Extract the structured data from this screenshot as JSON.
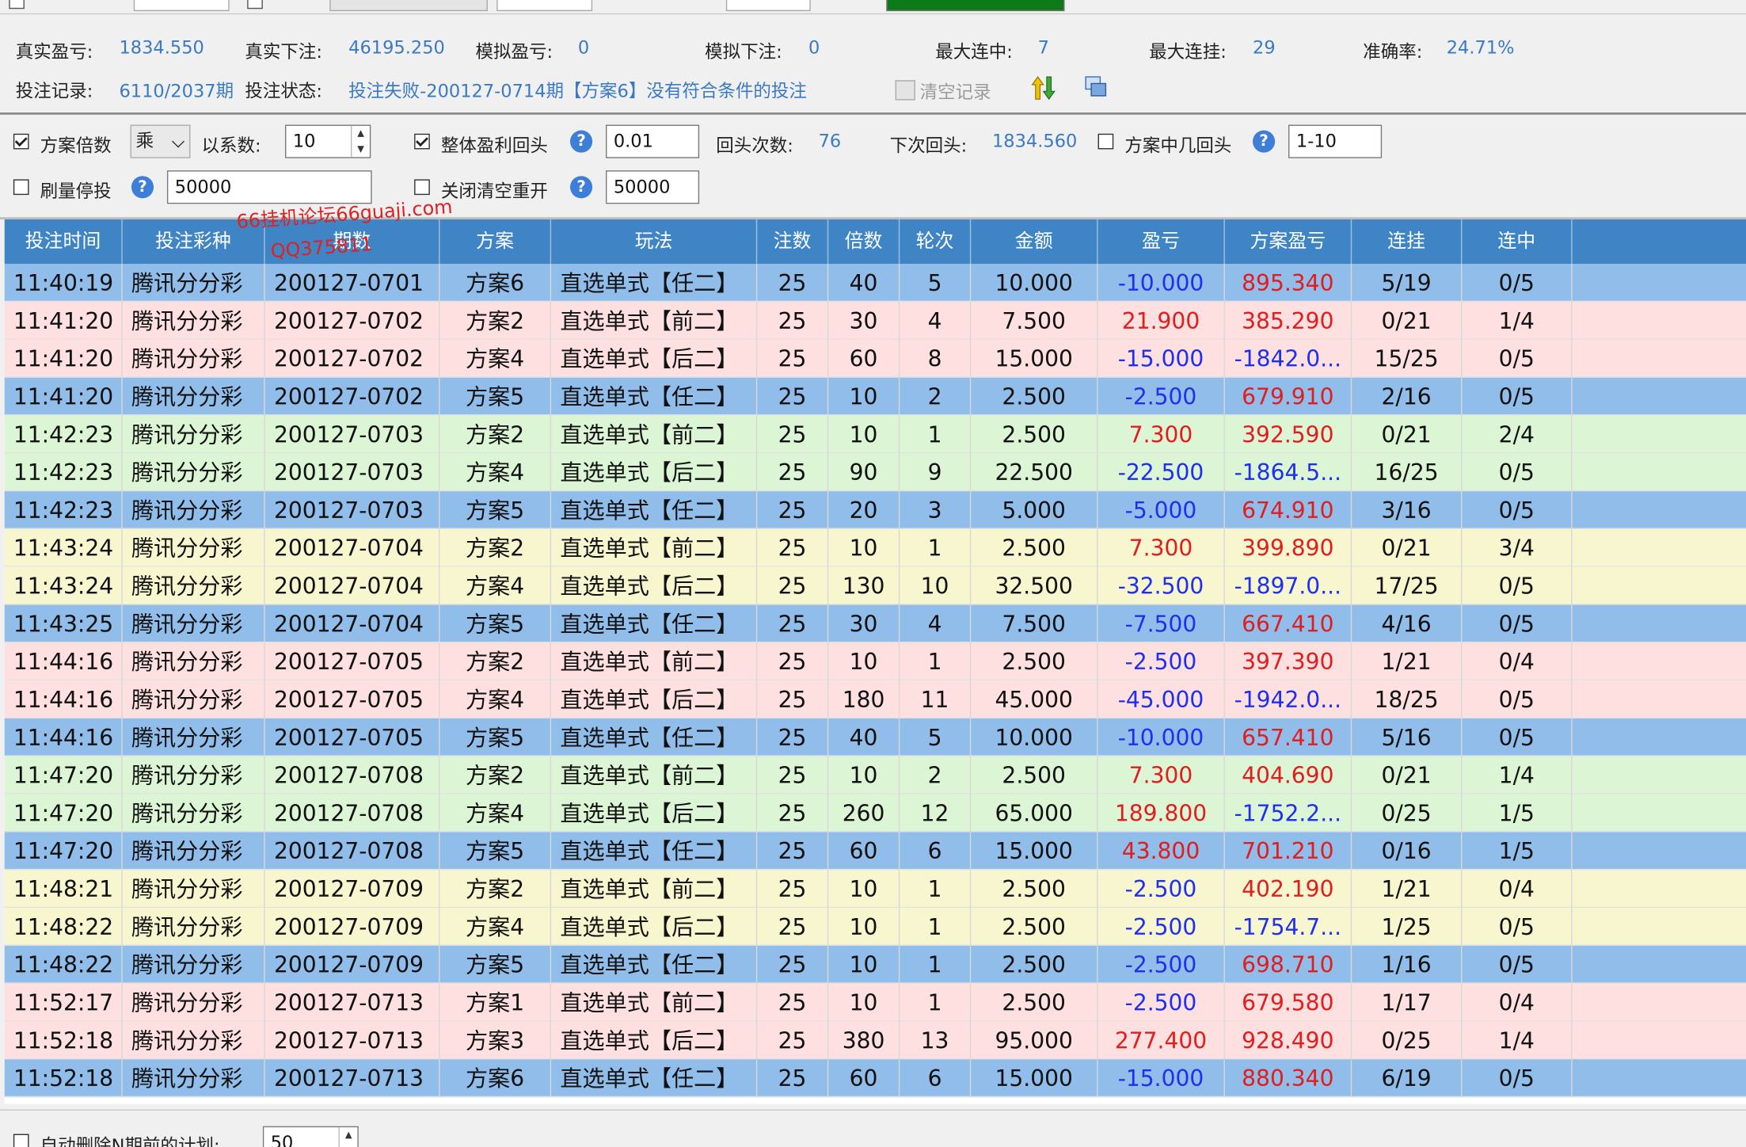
{
  "stats": {
    "real_profit_label": "真实盈亏:",
    "real_profit_value": "1834.550",
    "real_bet_label": "真实下注:",
    "real_bet_value": "46195.250",
    "sim_profit_label": "模拟盈亏:",
    "sim_profit_value": "0",
    "sim_bet_label": "模拟下注:",
    "sim_bet_value": "0",
    "max_win_streak_label": "最大连中:",
    "max_win_streak_value": "7",
    "max_loss_streak_label": "最大连挂:",
    "max_loss_streak_value": "29",
    "accuracy_label": "准确率:",
    "accuracy_value": "24.71%",
    "record_label": "投注记录:",
    "record_value": "6110/2037期",
    "status_label": "投注状态:",
    "status_value": "投注失败-200127-0714期【方案6】没有符合条件的投注",
    "clear_label": "清空记录"
  },
  "options": {
    "plan_multiplier_label": "方案倍数",
    "plan_multiplier_checked": true,
    "operator_value": "乘",
    "coefficient_label": "以系数:",
    "coefficient_value": "10",
    "overall_profit_label": "整体盈利回头",
    "overall_profit_checked": true,
    "overall_profit_value": "0.01",
    "return_count_label": "回头次数:",
    "return_count_value": "76",
    "next_return_label": "下次回头:",
    "next_return_value": "1834.560",
    "plan_return_label": "方案中几回头",
    "plan_return_checked": false,
    "plan_return_value": "1-10",
    "volume_stop_label": "刷量停投",
    "volume_stop_checked": false,
    "volume_stop_value": "50000",
    "close_clear_label": "关闭清空重开",
    "close_clear_checked": false,
    "close_clear_value": "50000"
  },
  "watermark": {
    "line1": "66挂机论坛66guaji.com",
    "line2": "QQ375811"
  },
  "table": {
    "columns": [
      "投注时间",
      "投注彩种",
      "期数",
      "方案",
      "玩法",
      "注数",
      "倍数",
      "轮次",
      "金额",
      "盈亏",
      "方案盈亏",
      "连挂",
      "连中"
    ],
    "rows": [
      {
        "bg": "blue",
        "time": "11:40:19",
        "lottery": "腾讯分分彩",
        "period": "200127-0701",
        "plan": "方案6",
        "play": "直选单式【任二】",
        "count": "25",
        "mult": "40",
        "round": "5",
        "amount": "10.000",
        "profit": "-10.000",
        "profit_sign": "neg",
        "plan_profit": "895.340",
        "plan_sign": "pos",
        "loss_streak": "5/19",
        "win_streak": "0/5"
      },
      {
        "bg": "pink",
        "time": "11:41:20",
        "lottery": "腾讯分分彩",
        "period": "200127-0702",
        "plan": "方案2",
        "play": "直选单式【前二】",
        "count": "25",
        "mult": "30",
        "round": "4",
        "amount": "7.500",
        "profit": "21.900",
        "profit_sign": "pos",
        "plan_profit": "385.290",
        "plan_sign": "pos",
        "loss_streak": "0/21",
        "win_streak": "1/4"
      },
      {
        "bg": "pink",
        "time": "11:41:20",
        "lottery": "腾讯分分彩",
        "period": "200127-0702",
        "plan": "方案4",
        "play": "直选单式【后二】",
        "count": "25",
        "mult": "60",
        "round": "8",
        "amount": "15.000",
        "profit": "-15.000",
        "profit_sign": "neg",
        "plan_profit": "-1842.0...",
        "plan_sign": "neg",
        "loss_streak": "15/25",
        "win_streak": "0/5"
      },
      {
        "bg": "blue",
        "time": "11:41:20",
        "lottery": "腾讯分分彩",
        "period": "200127-0702",
        "plan": "方案5",
        "play": "直选单式【任二】",
        "count": "25",
        "mult": "10",
        "round": "2",
        "amount": "2.500",
        "profit": "-2.500",
        "profit_sign": "neg",
        "plan_profit": "679.910",
        "plan_sign": "pos",
        "loss_streak": "2/16",
        "win_streak": "0/5"
      },
      {
        "bg": "green",
        "time": "11:42:23",
        "lottery": "腾讯分分彩",
        "period": "200127-0703",
        "plan": "方案2",
        "play": "直选单式【前二】",
        "count": "25",
        "mult": "10",
        "round": "1",
        "amount": "2.500",
        "profit": "7.300",
        "profit_sign": "pos",
        "plan_profit": "392.590",
        "plan_sign": "pos",
        "loss_streak": "0/21",
        "win_streak": "2/4"
      },
      {
        "bg": "green",
        "time": "11:42:23",
        "lottery": "腾讯分分彩",
        "period": "200127-0703",
        "plan": "方案4",
        "play": "直选单式【后二】",
        "count": "25",
        "mult": "90",
        "round": "9",
        "amount": "22.500",
        "profit": "-22.500",
        "profit_sign": "neg",
        "plan_profit": "-1864.5...",
        "plan_sign": "neg",
        "loss_streak": "16/25",
        "win_streak": "0/5"
      },
      {
        "bg": "blue",
        "time": "11:42:23",
        "lottery": "腾讯分分彩",
        "period": "200127-0703",
        "plan": "方案5",
        "play": "直选单式【任二】",
        "count": "25",
        "mult": "20",
        "round": "3",
        "amount": "5.000",
        "profit": "-5.000",
        "profit_sign": "neg",
        "plan_profit": "674.910",
        "plan_sign": "pos",
        "loss_streak": "3/16",
        "win_streak": "0/5"
      },
      {
        "bg": "yellow",
        "time": "11:43:24",
        "lottery": "腾讯分分彩",
        "period": "200127-0704",
        "plan": "方案2",
        "play": "直选单式【前二】",
        "count": "25",
        "mult": "10",
        "round": "1",
        "amount": "2.500",
        "profit": "7.300",
        "profit_sign": "pos",
        "plan_profit": "399.890",
        "plan_sign": "pos",
        "loss_streak": "0/21",
        "win_streak": "3/4"
      },
      {
        "bg": "yellow",
        "time": "11:43:24",
        "lottery": "腾讯分分彩",
        "period": "200127-0704",
        "plan": "方案4",
        "play": "直选单式【后二】",
        "count": "25",
        "mult": "130",
        "round": "10",
        "amount": "32.500",
        "profit": "-32.500",
        "profit_sign": "neg",
        "plan_profit": "-1897.0...",
        "plan_sign": "neg",
        "loss_streak": "17/25",
        "win_streak": "0/5"
      },
      {
        "bg": "blue",
        "time": "11:43:25",
        "lottery": "腾讯分分彩",
        "period": "200127-0704",
        "plan": "方案5",
        "play": "直选单式【任二】",
        "count": "25",
        "mult": "30",
        "round": "4",
        "amount": "7.500",
        "profit": "-7.500",
        "profit_sign": "neg",
        "plan_profit": "667.410",
        "plan_sign": "pos",
        "loss_streak": "4/16",
        "win_streak": "0/5"
      },
      {
        "bg": "pink",
        "time": "11:44:16",
        "lottery": "腾讯分分彩",
        "period": "200127-0705",
        "plan": "方案2",
        "play": "直选单式【前二】",
        "count": "25",
        "mult": "10",
        "round": "1",
        "amount": "2.500",
        "profit": "-2.500",
        "profit_sign": "neg",
        "plan_profit": "397.390",
        "plan_sign": "pos",
        "loss_streak": "1/21",
        "win_streak": "0/4"
      },
      {
        "bg": "pink",
        "time": "11:44:16",
        "lottery": "腾讯分分彩",
        "period": "200127-0705",
        "plan": "方案4",
        "play": "直选单式【后二】",
        "count": "25",
        "mult": "180",
        "round": "11",
        "amount": "45.000",
        "profit": "-45.000",
        "profit_sign": "neg",
        "plan_profit": "-1942.0...",
        "plan_sign": "neg",
        "loss_streak": "18/25",
        "win_streak": "0/5"
      },
      {
        "bg": "blue",
        "time": "11:44:16",
        "lottery": "腾讯分分彩",
        "period": "200127-0705",
        "plan": "方案5",
        "play": "直选单式【任二】",
        "count": "25",
        "mult": "40",
        "round": "5",
        "amount": "10.000",
        "profit": "-10.000",
        "profit_sign": "neg",
        "plan_profit": "657.410",
        "plan_sign": "pos",
        "loss_streak": "5/16",
        "win_streak": "0/5"
      },
      {
        "bg": "green",
        "time": "11:47:20",
        "lottery": "腾讯分分彩",
        "period": "200127-0708",
        "plan": "方案2",
        "play": "直选单式【前二】",
        "count": "25",
        "mult": "10",
        "round": "2",
        "amount": "2.500",
        "profit": "7.300",
        "profit_sign": "pos",
        "plan_profit": "404.690",
        "plan_sign": "pos",
        "loss_streak": "0/21",
        "win_streak": "1/4"
      },
      {
        "bg": "green",
        "time": "11:47:20",
        "lottery": "腾讯分分彩",
        "period": "200127-0708",
        "plan": "方案4",
        "play": "直选单式【后二】",
        "count": "25",
        "mult": "260",
        "round": "12",
        "amount": "65.000",
        "profit": "189.800",
        "profit_sign": "pos",
        "plan_profit": "-1752.2...",
        "plan_sign": "neg",
        "loss_streak": "0/25",
        "win_streak": "1/5"
      },
      {
        "bg": "blue",
        "time": "11:47:20",
        "lottery": "腾讯分分彩",
        "period": "200127-0708",
        "plan": "方案5",
        "play": "直选单式【任二】",
        "count": "25",
        "mult": "60",
        "round": "6",
        "amount": "15.000",
        "profit": "43.800",
        "profit_sign": "pos",
        "plan_profit": "701.210",
        "plan_sign": "pos",
        "loss_streak": "0/16",
        "win_streak": "1/5"
      },
      {
        "bg": "yellow",
        "time": "11:48:21",
        "lottery": "腾讯分分彩",
        "period": "200127-0709",
        "plan": "方案2",
        "play": "直选单式【前二】",
        "count": "25",
        "mult": "10",
        "round": "1",
        "amount": "2.500",
        "profit": "-2.500",
        "profit_sign": "neg",
        "plan_profit": "402.190",
        "plan_sign": "pos",
        "loss_streak": "1/21",
        "win_streak": "0/4"
      },
      {
        "bg": "yellow",
        "time": "11:48:22",
        "lottery": "腾讯分分彩",
        "period": "200127-0709",
        "plan": "方案4",
        "play": "直选单式【后二】",
        "count": "25",
        "mult": "10",
        "round": "1",
        "amount": "2.500",
        "profit": "-2.500",
        "profit_sign": "neg",
        "plan_profit": "-1754.7...",
        "plan_sign": "neg",
        "loss_streak": "1/25",
        "win_streak": "0/5"
      },
      {
        "bg": "blue",
        "time": "11:48:22",
        "lottery": "腾讯分分彩",
        "period": "200127-0709",
        "plan": "方案5",
        "play": "直选单式【任二】",
        "count": "25",
        "mult": "10",
        "round": "1",
        "amount": "2.500",
        "profit": "-2.500",
        "profit_sign": "neg",
        "plan_profit": "698.710",
        "plan_sign": "pos",
        "loss_streak": "1/16",
        "win_streak": "0/5"
      },
      {
        "bg": "pink",
        "time": "11:52:17",
        "lottery": "腾讯分分彩",
        "period": "200127-0713",
        "plan": "方案1",
        "play": "直选单式【前二】",
        "count": "25",
        "mult": "10",
        "round": "1",
        "amount": "2.500",
        "profit": "-2.500",
        "profit_sign": "neg",
        "plan_profit": "679.580",
        "plan_sign": "pos",
        "loss_streak": "1/17",
        "win_streak": "0/4"
      },
      {
        "bg": "pink",
        "time": "11:52:18",
        "lottery": "腾讯分分彩",
        "period": "200127-0713",
        "plan": "方案3",
        "play": "直选单式【后二】",
        "count": "25",
        "mult": "380",
        "round": "13",
        "amount": "95.000",
        "profit": "277.400",
        "profit_sign": "pos",
        "plan_profit": "928.490",
        "plan_sign": "pos",
        "loss_streak": "0/25",
        "win_streak": "1/4"
      },
      {
        "bg": "blue",
        "time": "11:52:18",
        "lottery": "腾讯分分彩",
        "period": "200127-0713",
        "plan": "方案6",
        "play": "直选单式【任二】",
        "count": "25",
        "mult": "60",
        "round": "6",
        "amount": "15.000",
        "profit": "-15.000",
        "profit_sign": "neg",
        "plan_profit": "880.340",
        "plan_sign": "pos",
        "loss_streak": "6/19",
        "win_streak": "0/5"
      }
    ]
  },
  "bottom": {
    "auto_delete_label": "自动删除N期前的计划:",
    "auto_delete_checked": false,
    "auto_delete_value": "50"
  },
  "colors": {
    "header_bg": "#3f85c5",
    "row_blue": "#91bdea",
    "row_pink": "#fde0df",
    "row_green": "#dcf5d5",
    "row_yellow": "#f7f6cf",
    "negative": "#1f2ff0",
    "positive": "#e11d1d",
    "value_text": "#3a79c4"
  }
}
